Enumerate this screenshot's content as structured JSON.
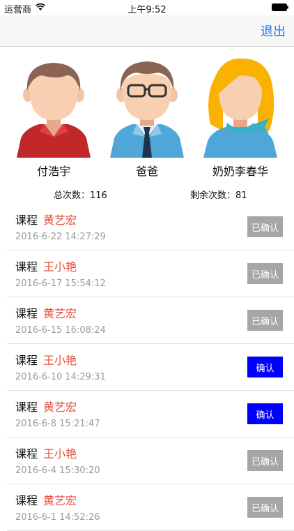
{
  "status_bar": {
    "carrier": "运营商",
    "time": "上午9:52"
  },
  "navbar": {
    "logout_label": "退出"
  },
  "members": [
    {
      "name": "付浩宇",
      "avatar": "boy-red-shirt-icon"
    },
    {
      "name": "爸爸",
      "avatar": "man-glasses-tie-icon"
    },
    {
      "name": "奶奶李春华",
      "avatar": "woman-blonde-scarf-icon"
    }
  ],
  "counts": {
    "total": "总次数：116",
    "remaining": "剩余次数：81"
  },
  "records": [
    {
      "label": "课程",
      "teacher": "黄艺宏",
      "time": "2016-6-22 14:27:29",
      "button": "已确认",
      "state": "confirmed"
    },
    {
      "label": "课程",
      "teacher": "王小艳",
      "time": "2016-6-17 15:54:12",
      "button": "已确认",
      "state": "confirmed"
    },
    {
      "label": "课程",
      "teacher": "黄艺宏",
      "time": "2016-6-15 16:08:24",
      "button": "已确认",
      "state": "confirmed"
    },
    {
      "label": "课程",
      "teacher": "王小艳",
      "time": "2016-6-10 14:29:31",
      "button": "确认",
      "state": "pending"
    },
    {
      "label": "课程",
      "teacher": "黄艺宏",
      "time": "2016-6-8 15:21:47",
      "button": "确认",
      "state": "pending"
    },
    {
      "label": "课程",
      "teacher": "王小艳",
      "time": "2016-6-4 15:30:20",
      "button": "已确认",
      "state": "confirmed"
    },
    {
      "label": "课程",
      "teacher": "黄艺宏",
      "time": "2016-6-1 14:52:26",
      "button": "已确认",
      "state": "confirmed"
    }
  ],
  "colors": {
    "accent": "#1c7cf0",
    "teacher": "#e74c3c",
    "confirm": "#0000ff",
    "confirmed": "#a6a6a6"
  }
}
